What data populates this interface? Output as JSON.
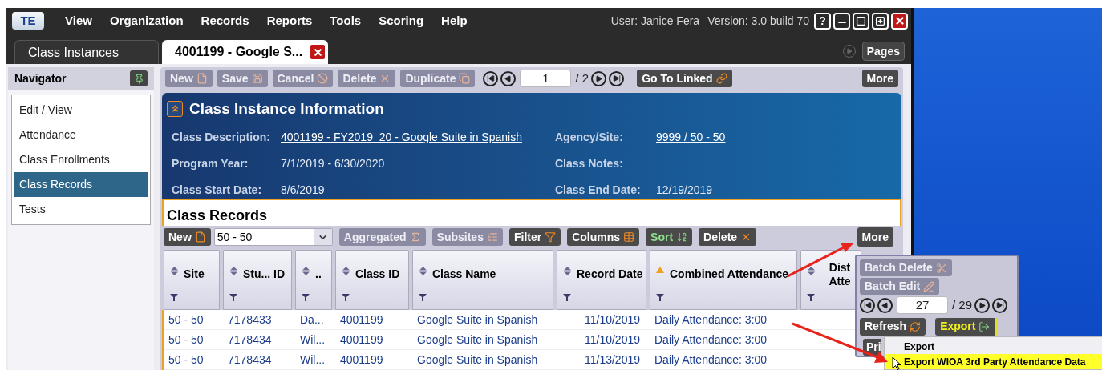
{
  "menu": {
    "logo": "TE",
    "items": [
      "View",
      "Organization",
      "Records",
      "Reports",
      "Tools",
      "Scoring",
      "Help"
    ],
    "user": "User: Janice Fera",
    "version": "Version: 3.0 build 70",
    "help": "?"
  },
  "tabs": [
    {
      "label": "Class Instances",
      "selected": false
    },
    {
      "label": "4001199 - Google S...",
      "selected": true
    }
  ],
  "pages_button": "Pages",
  "navigator": {
    "title": "Navigator",
    "items": [
      {
        "label": "Edit / View",
        "selected": false
      },
      {
        "label": "Attendance",
        "selected": false
      },
      {
        "label": "Class Enrollments",
        "selected": false
      },
      {
        "label": "Class Records",
        "selected": true
      },
      {
        "label": "Tests",
        "selected": false
      }
    ]
  },
  "toolbar": {
    "buttons": [
      {
        "kind": "new",
        "label": "New",
        "disabled": true
      },
      {
        "kind": "save",
        "label": "Save",
        "disabled": true
      },
      {
        "kind": "cancel",
        "label": "Cancel",
        "disabled": true
      },
      {
        "kind": "delete",
        "label": "Delete",
        "disabled": true
      },
      {
        "kind": "duplicate",
        "label": "Duplicate",
        "disabled": true
      }
    ],
    "page": "1",
    "total": "/ 2",
    "linked": "Go To Linked",
    "more": "More"
  },
  "info": {
    "title": "Class Instance Information",
    "rows": [
      [
        {
          "label": "Class Description:",
          "value": "4001199 - FY2019_20 - Google Suite in Spanish",
          "link": true
        },
        {
          "label": "Agency/Site:",
          "value": "9999 / 50 - 50",
          "link": true
        }
      ],
      [
        {
          "label": "Program Year:",
          "value": "7/1/2019 - 6/30/2020",
          "link": false
        },
        {
          "label": "Class Notes:"
        }
      ],
      [
        {
          "label": "Class Start Date:",
          "value": "8/6/2019",
          "link": false
        },
        {
          "label": "Class End Date:",
          "value": "12/19/2019",
          "link": false
        }
      ]
    ]
  },
  "records": {
    "title": "Class Records",
    "new": "New",
    "site_select": "50 - 50",
    "buttons": [
      {
        "kind": "aggregated",
        "label": "Aggregated",
        "disabled": true,
        "active": false
      },
      {
        "kind": "subsites",
        "label": "Subsites",
        "disabled": true,
        "active": false
      },
      {
        "kind": "filter",
        "label": "Filter",
        "disabled": false,
        "active": false
      },
      {
        "kind": "columns",
        "label": "Columns",
        "disabled": false,
        "active": false
      },
      {
        "kind": "sort",
        "label": "Sort",
        "disabled": false,
        "active": true
      },
      {
        "kind": "delete",
        "label": "Delete",
        "disabled": false,
        "active": false
      }
    ],
    "more": "More",
    "columns": [
      {
        "label": "Site",
        "sorted": false
      },
      {
        "label": "Stu... ID",
        "sorted": false
      },
      {
        "label": "..",
        "sorted": false
      },
      {
        "label": "Class ID",
        "sorted": false
      },
      {
        "label": "Class Name",
        "sorted": false
      },
      {
        "label": "Record Date",
        "sorted": false
      },
      {
        "label": "Combined Attendance",
        "sorted": true
      },
      {
        "label": "Dist Atte",
        "sorted": false
      }
    ],
    "rows": [
      [
        "50 - 50",
        "7178433",
        "Da...",
        "4001199",
        "Google Suite in Spanish",
        "11/10/2019",
        "Daily Attendance: 3:00"
      ],
      [
        "50 - 50",
        "7178434",
        "Wil...",
        "4001199",
        "Google Suite in Spanish",
        "11/10/2019",
        "Daily Attendance: 3:00"
      ],
      [
        "50 - 50",
        "7178434",
        "Wil...",
        "4001199",
        "Google Suite in Spanish",
        "11/13/2019",
        "Daily Attendance: 3:00"
      ]
    ]
  },
  "more_menu": {
    "buttons": [
      {
        "label": "Batch Delete",
        "kind": "batch-delete",
        "disabled": true
      },
      {
        "label": "Batch Edit",
        "kind": "batch-edit",
        "disabled": true
      }
    ],
    "page": "27",
    "total": "/ 29",
    "actions": [
      {
        "label": "Refresh",
        "kind": "refresh",
        "selected": false
      },
      {
        "label": "Export",
        "kind": "export",
        "selected": true
      }
    ],
    "cut_button": "Pri"
  },
  "submenu": {
    "items": [
      {
        "label": "Export",
        "selected": false
      },
      {
        "label": "Export WIOA 3rd Party Attendance Data",
        "selected": true
      }
    ]
  }
}
